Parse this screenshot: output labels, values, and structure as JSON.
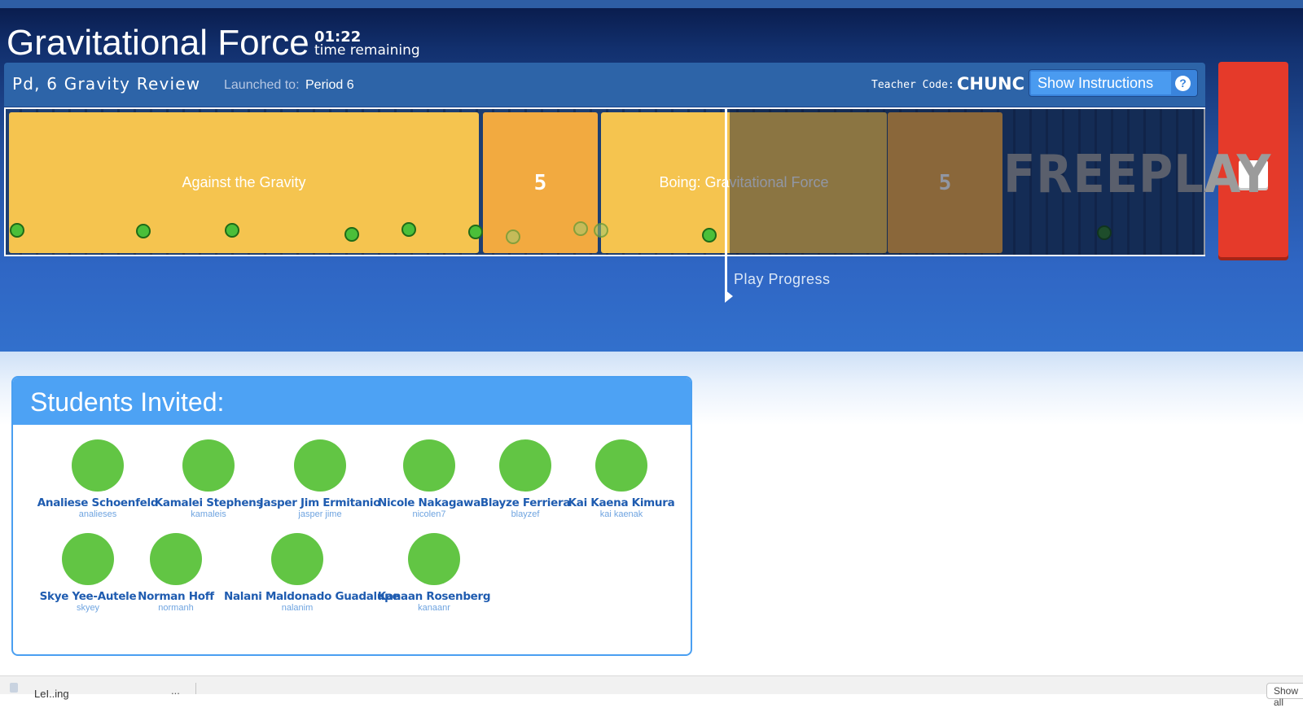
{
  "header": {
    "title": "Gravitational Force",
    "timer_value": "01:22",
    "timer_label": "time remaining"
  },
  "subbar": {
    "assignment_name": "Pd, 6 Gravity Review",
    "launched_label": "Launched to:",
    "launched_value": "Period 6",
    "teacher_code_label": "Teacher Code:",
    "teacher_code_value": "CHUNC",
    "instructions_label": "Show Instructions",
    "help_glyph": "?"
  },
  "timeline": {
    "segments": [
      {
        "label": "Against the Gravity",
        "color": "#f5c44f"
      },
      {
        "label": "5",
        "color": "#f2aa40"
      },
      {
        "label": "Boing: Gravitational Force",
        "color": "#f5c44f"
      },
      {
        "label": "",
        "color": "#f5c44f"
      },
      {
        "label": "5",
        "color": "#f2aa40"
      }
    ],
    "freeplay_label": "FREEPLAY",
    "progress_label": "Play Progress",
    "dots_total": 11
  },
  "students": {
    "heading": "Students Invited:",
    "list": [
      {
        "name": "Analiese Schoenfeld",
        "username": "analieses"
      },
      {
        "name": "Kamalei Stephens",
        "username": "kamaleis"
      },
      {
        "name": "Jasper Jim Ermitanio",
        "username": "jasper jime"
      },
      {
        "name": "Nicole Nakagawa",
        "username": "nicolen7"
      },
      {
        "name": "Blayze Ferriera",
        "username": "blayzef"
      },
      {
        "name": "Kai Kaena Kimura",
        "username": "kai kaenak"
      },
      {
        "name": "Skye Yee-Autele",
        "username": "skyey"
      },
      {
        "name": "Norman Hoff",
        "username": "normanh"
      },
      {
        "name": "Nalani Maldonado Guadalupe",
        "username": "nalanim"
      },
      {
        "name": "Kanaan Rosenberg",
        "username": "kanaanr"
      }
    ]
  },
  "downloads": {
    "file_name": "LeI..ing",
    "more_glyph": "...",
    "show_all_label": "Show all"
  },
  "colors": {
    "accent": "#4da2f4",
    "stop": "#e53a2a",
    "avatar": "#62c544"
  }
}
